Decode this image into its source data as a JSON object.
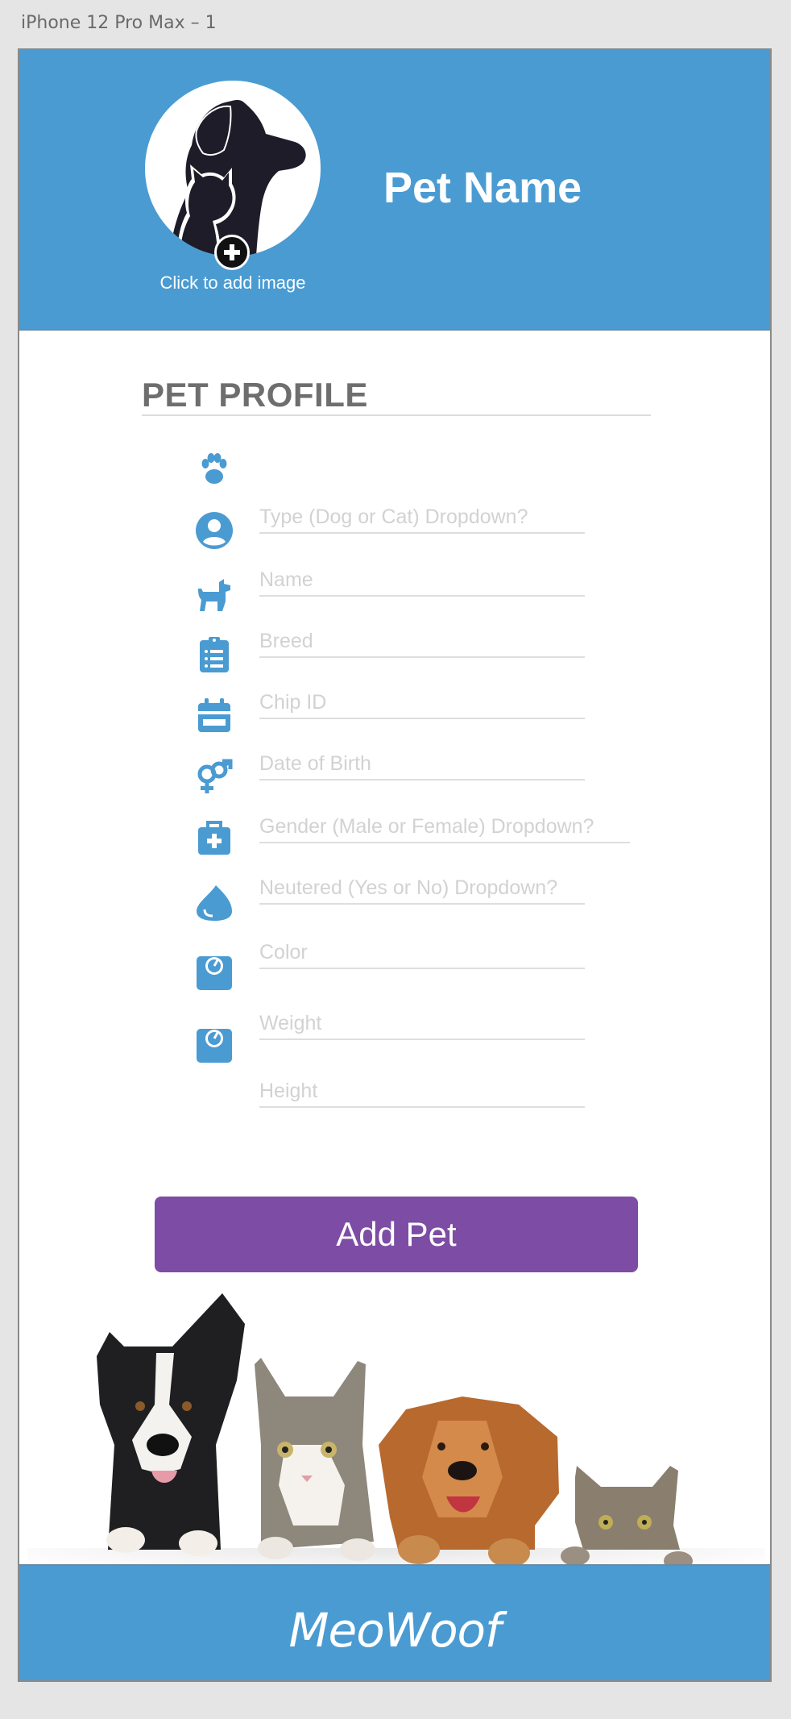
{
  "artboard": {
    "label": "iPhone 12 Pro Max – 1"
  },
  "colors": {
    "primary_blue": "#4a9bd2",
    "button_purple": "#7d4ca4",
    "title_gray": "#6e6e6e",
    "placeholder_gray": "#d2d2d2"
  },
  "header": {
    "pet_name": "Pet Name",
    "avatar_caption": "Click to add image",
    "avatar_icon": "dog-cat-silhouette-icon",
    "add_icon": "plus-circle-icon"
  },
  "profile": {
    "title": "PET PROFILE",
    "fields": [
      {
        "icon": "paw-icon",
        "placeholder": "Type (Dog or Cat) Dropdown?"
      },
      {
        "icon": "user-circle-icon",
        "placeholder": "Name"
      },
      {
        "icon": "dog-icon",
        "placeholder": "Breed"
      },
      {
        "icon": "clipboard-list-icon",
        "placeholder": "Chip ID"
      },
      {
        "icon": "calendar-icon",
        "placeholder": "Date of Birth"
      },
      {
        "icon": "gender-icon",
        "placeholder": "Gender (Male or Female) Dropdown?"
      },
      {
        "icon": "medical-kit-icon",
        "placeholder": "Neutered (Yes or No) Dropdown?"
      },
      {
        "icon": "drop-icon",
        "placeholder": "Color"
      },
      {
        "icon": "weight-scale-icon",
        "placeholder": "Weight"
      },
      {
        "icon": "weight-scale-icon",
        "placeholder": "Height"
      }
    ]
  },
  "actions": {
    "add_pet_label": "Add Pet"
  },
  "footer": {
    "brand": "MeoWoof"
  }
}
